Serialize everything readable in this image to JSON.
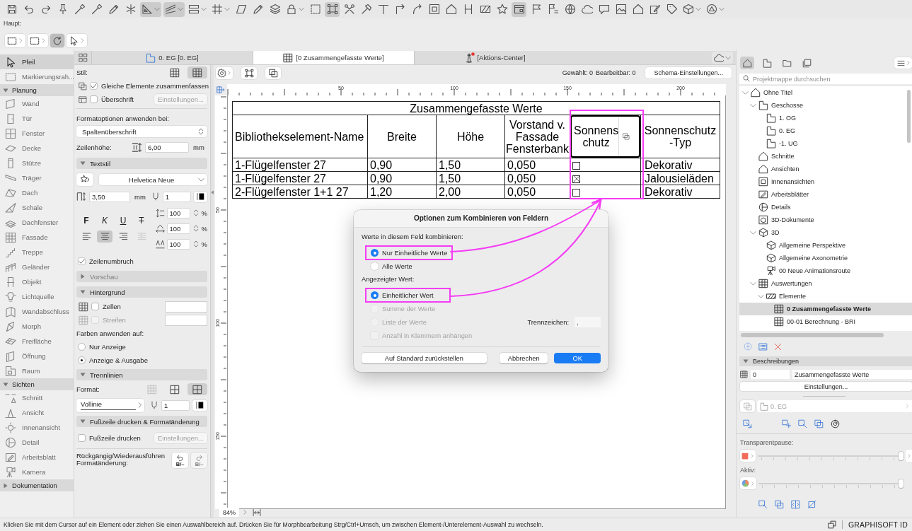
{
  "toolbar": {
    "buttons": [
      {
        "selected": false,
        "menu": false
      },
      {
        "selected": false,
        "menu": false
      },
      {
        "selected": false,
        "menu": false
      },
      {
        "selected": false,
        "menu": false
      },
      {
        "selected": false,
        "menu": false
      },
      {
        "selected": false,
        "menu": false
      },
      {
        "selected": false,
        "menu": false
      },
      {
        "selected": false,
        "menu": false
      },
      {
        "selected": true,
        "menu": true
      },
      {
        "selected": true,
        "menu": true
      },
      {
        "selected": false,
        "menu": true
      },
      {
        "selected": false,
        "menu": true
      },
      {
        "selected": false,
        "menu": false
      },
      {
        "selected": false,
        "menu": false
      },
      {
        "selected": false,
        "menu": false
      },
      {
        "selected": false,
        "menu": true
      },
      {
        "selected": false,
        "menu": false
      },
      {
        "selected": true,
        "menu": false
      },
      {
        "selected": false,
        "menu": false
      },
      {
        "selected": false,
        "menu": false
      },
      {
        "selected": false,
        "menu": false
      },
      {
        "selected": false,
        "menu": false
      },
      {
        "selected": false,
        "menu": false
      },
      {
        "selected": false,
        "menu": false
      },
      {
        "selected": false,
        "menu": false
      },
      {
        "selected": false,
        "menu": false
      },
      {
        "selected": false,
        "menu": false
      },
      {
        "selected": false,
        "menu": false
      },
      {
        "selected": true,
        "menu": false
      },
      {
        "selected": false,
        "menu": false
      },
      {
        "selected": false,
        "menu": false
      },
      {
        "selected": false,
        "menu": false
      },
      {
        "selected": false,
        "menu": false
      },
      {
        "selected": false,
        "menu": false
      },
      {
        "selected": false,
        "menu": false
      },
      {
        "selected": false,
        "menu": false
      },
      {
        "selected": false,
        "menu": false
      },
      {
        "selected": false,
        "menu": false
      },
      {
        "selected": false,
        "menu": true
      },
      {
        "selected": false,
        "menu": true
      }
    ]
  },
  "main_toolbar": {
    "label": "Haupt:",
    "buttons": [
      {
        "selected": false,
        "menu": true
      },
      {
        "selected": false,
        "menu": true
      },
      {
        "selected": true,
        "menu": false
      },
      {
        "selected": false,
        "menu": true
      }
    ]
  },
  "toolbox": {
    "tools": [
      {
        "label": "Pfeil",
        "selected": true
      },
      {
        "label": "Markierungsrah...",
        "selected": false
      }
    ],
    "groups": [
      {
        "label": "Planung",
        "expanded": true,
        "tools": [
          {
            "label": "Wand",
            "selected": false
          },
          {
            "label": "Tür",
            "selected": false
          },
          {
            "label": "Fenster",
            "selected": false
          },
          {
            "label": "Decke",
            "selected": false
          },
          {
            "label": "Stütze",
            "selected": false
          },
          {
            "label": "Träger",
            "selected": false
          },
          {
            "label": "Dach",
            "selected": false
          },
          {
            "label": "Schale",
            "selected": false
          },
          {
            "label": "Dachfenster",
            "selected": false
          },
          {
            "label": "Fassade",
            "selected": false
          },
          {
            "label": "Treppe",
            "selected": false
          },
          {
            "label": "Geländer",
            "selected": false
          },
          {
            "label": "Objekt",
            "selected": false
          },
          {
            "label": "Lichtquelle",
            "selected": false
          },
          {
            "label": "Wandabschluss",
            "selected": false
          },
          {
            "label": "Morph",
            "selected": false
          },
          {
            "label": "Freifläche",
            "selected": false
          },
          {
            "label": "Öffnung",
            "selected": false
          },
          {
            "label": "Raum",
            "selected": false
          }
        ]
      },
      {
        "label": "Sichten",
        "expanded": true,
        "tools": [
          {
            "label": "Schnitt",
            "selected": false
          },
          {
            "label": "Ansicht",
            "selected": false
          },
          {
            "label": "Innenansicht",
            "selected": false
          },
          {
            "label": "Detail",
            "selected": false
          },
          {
            "label": "Arbeitsblatt",
            "selected": false
          },
          {
            "label": "Kamera",
            "selected": false
          }
        ]
      },
      {
        "label": "Dokumentation",
        "expanded": false
      }
    ]
  },
  "tabs": {
    "items": [
      {
        "label": "0. EG [0. EG]",
        "kind": "floorplan",
        "selected": false,
        "alert": false
      },
      {
        "label": "[0 Zusammengefasste Werte]",
        "kind": "schedule",
        "selected": true,
        "alert": false
      },
      {
        "label": "[Aktions-Center]",
        "kind": "action",
        "selected": false,
        "alert": true
      }
    ]
  },
  "settings": {
    "style": {
      "label": "Stil:",
      "options": [
        {
          "selected": false
        },
        {
          "selected": true
        }
      ]
    },
    "merge_equal": {
      "label": "Gleiche Elemente zusammenfassen",
      "checked": true
    },
    "headline": {
      "label": "Überschrift",
      "checked": false,
      "button": {
        "label": "Einstellungen...",
        "disabled": true
      }
    },
    "format_target": {
      "label": "Formatoptionen anwenden bei:",
      "value": "Spaltenüberschrift"
    },
    "row_height": {
      "label": "Zeilenhöhe:",
      "value": "6,00",
      "unit": "mm"
    },
    "text_style": {
      "title": "Textstil",
      "expanded": true,
      "font": "Helvetica Neue",
      "size": "3,50",
      "unit": "mm",
      "pen": "1",
      "styles": [
        {
          "label": "F",
          "kind": "bold",
          "selected": false
        },
        {
          "label": "K",
          "kind": "italic",
          "selected": false
        },
        {
          "label": "U",
          "kind": "underline",
          "selected": false
        },
        {
          "label": "T",
          "kind": "strike",
          "selected": false
        }
      ],
      "alignments": [
        {
          "kind": "left",
          "selected": false,
          "disabled": false
        },
        {
          "kind": "center",
          "selected": true,
          "disabled": false
        },
        {
          "kind": "right",
          "selected": false,
          "disabled": false
        },
        {
          "kind": "columns",
          "selected": false,
          "disabled": true
        }
      ],
      "scales": [
        {
          "kind": "spacing",
          "value": "100",
          "unit": "%"
        },
        {
          "kind": "width",
          "value": "100",
          "unit": "%"
        },
        {
          "kind": "tracking",
          "value": "100",
          "unit": "%"
        }
      ]
    },
    "wrap": {
      "label": "Zeilenumbruch",
      "checked": true
    },
    "preview": {
      "title": "Vorschau",
      "expanded": false,
      "disabled": true
    },
    "background": {
      "title": "Hintergrund",
      "expanded": true,
      "rows": [
        {
          "label": "Zellen",
          "checked": false,
          "disabled": false
        },
        {
          "label": "Streifen",
          "checked": false,
          "disabled": true
        }
      ]
    },
    "colors": {
      "label": "Farben anwenden auf:",
      "options": [
        {
          "label": "Nur Anzeige",
          "selected": false
        },
        {
          "label": "Anzeige & Ausgabe",
          "selected": true
        }
      ]
    },
    "lines": {
      "title": "Trennlinien",
      "expanded": true,
      "format_label": "Format:",
      "formats": [
        {
          "selected": false,
          "disabled": true
        },
        {
          "selected": false,
          "disabled": false
        },
        {
          "selected": true,
          "disabled": false
        }
      ],
      "line_type": "Vollinie",
      "pen": "1"
    },
    "footer": {
      "title": "Fußzeile drucken & Formatänderung",
      "expanded": true,
      "print": {
        "label": "Fußzeile drucken",
        "checked": false
      },
      "button": {
        "label": "Einstellungen...",
        "disabled": true
      },
      "undo_label": "Rückgängig/Wiederausführen Formatänderung:",
      "undo_buttons": [
        {
          "label": "B/–",
          "kind": "undo",
          "disabled": false
        },
        {
          "label": "B/–",
          "kind": "redo",
          "disabled": true
        }
      ]
    }
  },
  "schedule": {
    "toolbar": {
      "selected_count": "Gewählt: 0",
      "editable_count": "Bearbeitbar: 0",
      "settings_button": "Schema-Einstellungen..."
    },
    "ruler": {
      "x_labels": [
        "50",
        "100",
        "150",
        "200"
      ],
      "y_labels": [
        "50",
        "100",
        "150"
      ]
    },
    "table": {
      "title": "Zusammengefasste Werte",
      "columns": [
        {
          "label": "Bibliothekselement-Name",
          "kind": "text",
          "selected": false,
          "highlighted": false
        },
        {
          "label": "Breite",
          "kind": "text",
          "selected": false,
          "highlighted": false
        },
        {
          "label": "Höhe",
          "kind": "text",
          "selected": false,
          "highlighted": false
        },
        {
          "label": "Vorstand v.\nFassade\nFensterbank",
          "kind": "text",
          "selected": false,
          "highlighted": false
        },
        {
          "label": "Sonnens\nchutz",
          "kind": "checkbox",
          "selected": true,
          "highlighted": true
        },
        {
          "label": "Sonnenschutz\n-Typ",
          "kind": "text",
          "selected": false,
          "highlighted": false
        }
      ],
      "rows": [
        {
          "cells": [
            {
              "text": "1-Flügelfenster 27"
            },
            {
              "text": "0,90"
            },
            {
              "text": "1,50"
            },
            {
              "text": "0,050"
            },
            {
              "checked": false
            },
            {
              "text": "Dekorativ"
            }
          ]
        },
        {
          "cells": [
            {
              "text": "1-Flügelfenster 27"
            },
            {
              "text": "0,90"
            },
            {
              "text": "1,50"
            },
            {
              "text": "0,050"
            },
            {
              "checked": true
            },
            {
              "text": "Jalousieläden"
            }
          ]
        },
        {
          "cells": [
            {
              "text": "2-Flügelfenster 1+1 27"
            },
            {
              "text": "1,20"
            },
            {
              "text": "2,00"
            },
            {
              "text": "0,050"
            },
            {
              "checked": false
            },
            {
              "text": "Dekorativ"
            }
          ]
        }
      ]
    },
    "zoom": "84%"
  },
  "dialog": {
    "title": "Optionen zum Kombinieren von Feldern",
    "groups": [
      {
        "label": "Werte in diesem Feld kombinieren:",
        "options": [
          {
            "label": "Nur Einheitliche Werte",
            "selected": true,
            "disabled": false,
            "highlighted": true
          },
          {
            "label": "Alle Werte",
            "selected": false,
            "disabled": false,
            "highlighted": false
          }
        ]
      },
      {
        "label": "Angezeigter Wert:",
        "options": [
          {
            "label": "Einheitlicher Wert",
            "selected": true,
            "disabled": false,
            "highlighted": true
          },
          {
            "label": "Summe der Werte",
            "selected": false,
            "disabled": true,
            "highlighted": false
          },
          {
            "label": "Liste der Werte",
            "selected": false,
            "disabled": true,
            "highlighted": false
          }
        ]
      }
    ],
    "separator": {
      "label": "Trennzeichen:",
      "value": ",",
      "disabled": true
    },
    "count": {
      "label": "Anzahl in Klammern anhängen",
      "checked": false,
      "disabled": true
    },
    "buttons": [
      {
        "label": "Auf Standard zurückstellen",
        "kind": "secondary"
      },
      {
        "label": "Abbrechen",
        "kind": "secondary"
      },
      {
        "label": "OK",
        "kind": "default"
      }
    ]
  },
  "navigator": {
    "views": [
      {
        "selected": true
      },
      {
        "selected": false
      },
      {
        "selected": false
      },
      {
        "selected": false
      }
    ],
    "search": {
      "placeholder": "Projektmappe durchsuchen"
    },
    "tree": [
      {
        "label": "Ohne Titel",
        "kind": "project",
        "selected": false,
        "expanded": true,
        "children": [
          {
            "label": "Geschosse",
            "kind": "stories",
            "selected": false,
            "expanded": true,
            "children": [
              {
                "label": "1. OG",
                "kind": "story",
                "selected": false
              },
              {
                "label": "0. EG",
                "kind": "story",
                "selected": false
              },
              {
                "label": "-1. UG",
                "kind": "story",
                "selected": false
              }
            ]
          },
          {
            "label": "Schnitte",
            "kind": "section",
            "selected": false
          },
          {
            "label": "Ansichten",
            "kind": "elevation",
            "selected": false
          },
          {
            "label": "Innenansichten",
            "kind": "interior",
            "selected": false
          },
          {
            "label": "Arbeitsblätter",
            "kind": "worksheet",
            "selected": false
          },
          {
            "label": "Details",
            "kind": "detail",
            "selected": false
          },
          {
            "label": "3D-Dokumente",
            "kind": "documents",
            "selected": false
          },
          {
            "label": "3D",
            "kind": "model",
            "selected": false,
            "expanded": true,
            "children": [
              {
                "label": "Allgemeine Perspektive",
                "kind": "perspective",
                "selected": false
              },
              {
                "label": "Allgemeine Axonometrie",
                "kind": "axonometry",
                "selected": false
              },
              {
                "label": "00 Neue Animationsroute",
                "kind": "camera",
                "selected": false
              }
            ]
          },
          {
            "label": "Auswertungen",
            "kind": "schedule",
            "selected": false,
            "expanded": true,
            "children": [
              {
                "label": "Elemente",
                "kind": "folder",
                "selected": false,
                "expanded": true,
                "children": [
                  {
                    "label": "0 Zusammengefasste Werte",
                    "kind": "schedule",
                    "selected": true
                  },
                  {
                    "label": "00-01 Berechnung - BRI",
                    "kind": "schedule",
                    "selected": false
                  }
                ]
              }
            ]
          }
        ]
      }
    ],
    "description": {
      "title": "Beschreibungen",
      "expanded": true,
      "code": "0",
      "name": "Zusammengefasste Werte",
      "button": "Einstellungen..."
    },
    "story": {
      "label": "0. EG",
      "disabled": true
    },
    "transparency": {
      "label": "Transparentpause:",
      "level": 1
    },
    "active": {
      "label": "Aktiv:",
      "level": 1
    }
  },
  "status_bar": {
    "message": "Klicken Sie mit dem Cursor auf ein Element oder ziehen Sie einen Auswahlbereich auf. Drücken Sie für Morphbearbeitung Strg/Ctrl+Umsch, um zwischen Element-/Unterelement-Auswahl zu wechseln.",
    "account": "GRAPHISOFT ID"
  }
}
